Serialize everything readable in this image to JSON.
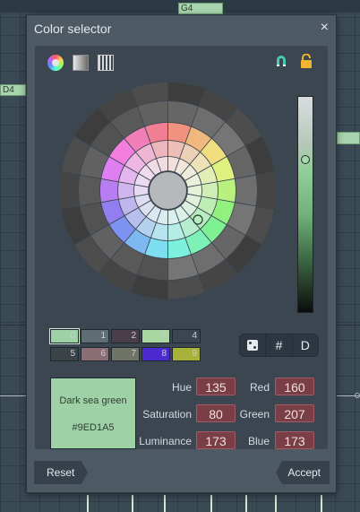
{
  "background": {
    "notes": [
      {
        "label": "G4"
      },
      {
        "label": "D4"
      },
      {
        "label": ""
      }
    ]
  },
  "dialog": {
    "title": "Color selector",
    "close_label": "×",
    "mode_icons": [
      "color-wheel-icon",
      "gradient-icon",
      "palette-grid-icon"
    ],
    "status_icons": [
      "magnet-icon",
      "lock-icon"
    ],
    "accent_colors": {
      "selected": "#9ED1A5",
      "value_bg": "#7A3F46"
    },
    "brightness_slider": {
      "value": 173,
      "max": 255
    },
    "palette": [
      {
        "index": "0",
        "color": "#9ED1A5"
      },
      {
        "index": "1",
        "color": "#5E6E74"
      },
      {
        "index": "2",
        "color": "#4A3E49"
      },
      {
        "index": "3",
        "color": "#A9D6A1"
      },
      {
        "index": "4",
        "color": "#3C4650"
      },
      {
        "index": "5",
        "color": "#3B4349"
      },
      {
        "index": "6",
        "color": "#8A6E74"
      },
      {
        "index": "7",
        "color": "#6F7466"
      },
      {
        "index": "8",
        "color": "#4B2BCF"
      },
      {
        "index": "9",
        "color": "#A8B23A"
      }
    ],
    "tools": {
      "random_label": "",
      "hex_label": "#",
      "default_label": "D"
    },
    "preview": {
      "name": "Dark sea green",
      "hex": "#9ED1A5",
      "color": "#9ED1A5"
    },
    "fields": {
      "hue_label": "Hue",
      "hue_value": "135",
      "saturation_label": "Saturation",
      "saturation_value": "80",
      "luminance_label": "Luminance",
      "luminance_value": "173",
      "red_label": "Red",
      "red_value": "160",
      "green_label": "Green",
      "green_value": "207",
      "blue_label": "Blue",
      "blue_value": "173"
    },
    "footer": {
      "reset_label": "Reset",
      "accept_label": "Accept"
    }
  }
}
